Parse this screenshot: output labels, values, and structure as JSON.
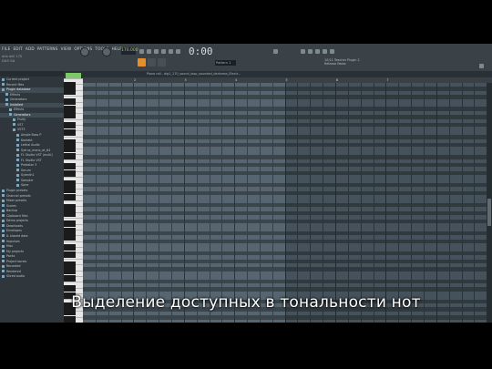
{
  "menu": [
    "FILE",
    "EDIT",
    "ADD",
    "PATTERNS",
    "VIEW",
    "OPTIONS",
    "TOOLS",
    "HELP"
  ],
  "project": [
    "dnb drill 170",
    "D#5 G#"
  ],
  "tempo": "170.000",
  "time": "0:00",
  "time_sub": "00",
  "pattern": "Pattern 1",
  "news": [
    "10/11 Teacher Plugin 2",
    "Release News"
  ],
  "roll_title": "Piano roll - dig1_170_sound_loop_sounded_darkness_Electr...",
  "ruler": [
    "2",
    "3",
    "4",
    "5",
    "6",
    "7"
  ],
  "sidebar": [
    {
      "label": "Current project",
      "sel": false
    },
    {
      "label": "Recent files",
      "sel": false
    },
    {
      "label": "Plugin database",
      "sel": true
    },
    {
      "label": "Effects",
      "sel": false
    },
    {
      "label": "Generators",
      "sel": false
    },
    {
      "label": "Installed",
      "sel": true
    },
    {
      "label": "Effects",
      "sel": false
    },
    {
      "label": "Generators",
      "sel": true
    },
    {
      "label": "Fruity",
      "sel": false
    },
    {
      "label": "VST",
      "sel": false
    },
    {
      "label": "VST3",
      "sel": false
    },
    {
      "label": "Ample Bass P",
      "sel": false
    },
    {
      "label": "Kontakt",
      "sel": false
    },
    {
      "label": "Lethal Audio",
      "sel": false
    },
    {
      "label": "Sytrus_mono_at_64",
      "sel": false
    },
    {
      "label": "FL Studio VST (multi)",
      "sel": false
    },
    {
      "label": "FL Studio VST",
      "sel": false
    },
    {
      "label": "Predator 3",
      "sel": false
    },
    {
      "label": "Serum",
      "sel": false
    },
    {
      "label": "Sylenth1",
      "sel": false
    },
    {
      "label": "Sampler",
      "sel": false
    },
    {
      "label": "Spire",
      "sel": false
    },
    {
      "label": "Plugin presets",
      "sel": false
    },
    {
      "label": "Channel presets",
      "sel": false
    },
    {
      "label": "Mixer presets",
      "sel": false
    },
    {
      "label": "Scores",
      "sel": false
    },
    {
      "label": "Backup",
      "sel": false
    },
    {
      "label": "Clipboard files",
      "sel": false
    },
    {
      "label": "Demo projects",
      "sel": false
    },
    {
      "label": "Downloads",
      "sel": false
    },
    {
      "label": "Envelopes",
      "sel": false
    },
    {
      "label": "IL shared data",
      "sel": false
    },
    {
      "label": "Impulses",
      "sel": false
    },
    {
      "label": "Misc",
      "sel": false
    },
    {
      "label": "My projects",
      "sel": false
    },
    {
      "label": "Packs",
      "sel": false
    },
    {
      "label": "Project bones",
      "sel": false
    },
    {
      "label": "Recorded",
      "sel": false
    },
    {
      "label": "Rendered",
      "sel": false
    },
    {
      "label": "Sliced audio",
      "sel": false
    }
  ],
  "subtitle": "Выделение доступных в тональности нот",
  "colors": {
    "accent": "#e58f2b",
    "key_highlight": "#7dc96a",
    "grid_light": "#566570",
    "grid_dark": "#3b464c"
  }
}
